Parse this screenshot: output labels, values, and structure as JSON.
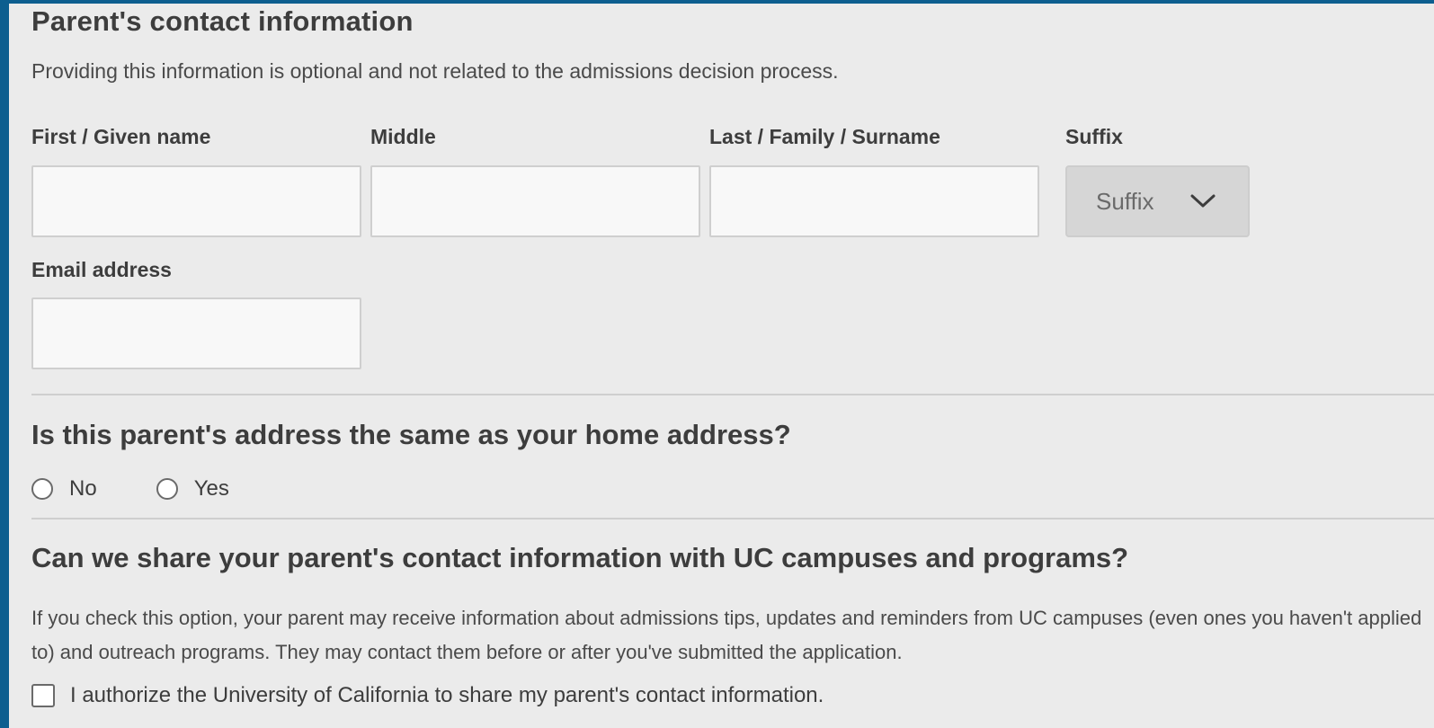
{
  "section": {
    "title": "Parent's contact information",
    "intro": "Providing this information is optional and not related to the admissions decision process."
  },
  "name_fields": {
    "first_label": "First / Given name",
    "first_value": "",
    "middle_label": "Middle",
    "middle_value": "",
    "last_label": "Last / Family / Surname",
    "last_value": "",
    "suffix_label": "Suffix",
    "suffix_value": "Suffix"
  },
  "email": {
    "label": "Email address",
    "value": ""
  },
  "address_question": {
    "text": "Is this parent's address the same as your home address?",
    "options": [
      "No",
      "Yes"
    ],
    "selected": null
  },
  "share_question": {
    "text": "Can we share your parent's contact information with UC campuses and programs?",
    "explanation": "If you check this option, your parent may receive information about admissions tips, updates and reminders from UC campuses (even ones you haven't applied to) and outreach programs. They may contact them before or after you've submitted the application.",
    "checkbox_label": "I authorize the University of California to share my parent's contact information.",
    "checked": false
  },
  "colors": {
    "frame_accent": "#0d5e8f",
    "panel_background": "#ebebeb",
    "input_background": "#f8f8f8",
    "select_background": "#d6d6d6"
  },
  "icons": {
    "suffix_dropdown": "chevron-down-icon"
  }
}
